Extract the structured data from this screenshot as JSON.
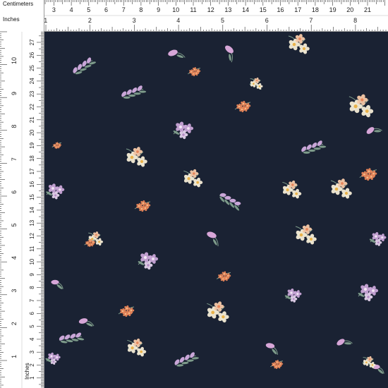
{
  "rulers": {
    "top_unit_label": "Centimeters",
    "second_unit_label": "Inches",
    "left_unit_label": "Inches",
    "top_cm": [
      "1",
      "2",
      "3",
      "4",
      "5",
      "6",
      "7",
      "8",
      "9",
      "10",
      "11",
      "12",
      "13",
      "14",
      "15",
      "16",
      "17",
      "18",
      "19",
      "20",
      "21"
    ],
    "top_in": [
      "1",
      "2",
      "3",
      "4",
      "5",
      "6",
      "7",
      "8"
    ],
    "left_cm": [
      "27",
      "26",
      "25",
      "24",
      "23",
      "22",
      "21",
      "20",
      "19",
      "18",
      "17",
      "16",
      "15",
      "14",
      "13",
      "12",
      "11",
      "10",
      "9",
      "8",
      "7",
      "6",
      "5",
      "4",
      "3",
      "2",
      "1"
    ],
    "left_in": [
      "10",
      "9",
      "8",
      "7",
      "6",
      "5",
      "4",
      "3",
      "2",
      "1"
    ]
  },
  "fabric": {
    "background_color": "#1a2233",
    "pattern": "scattered small floral sprigs in cream, lilac and coral on navy"
  },
  "colors": {
    "navy": "#1a2233",
    "cream": "#f4ecd6",
    "lilac": "#c9a6d8",
    "coral": "#e8865a",
    "leaf": "#7d9b8a"
  }
}
